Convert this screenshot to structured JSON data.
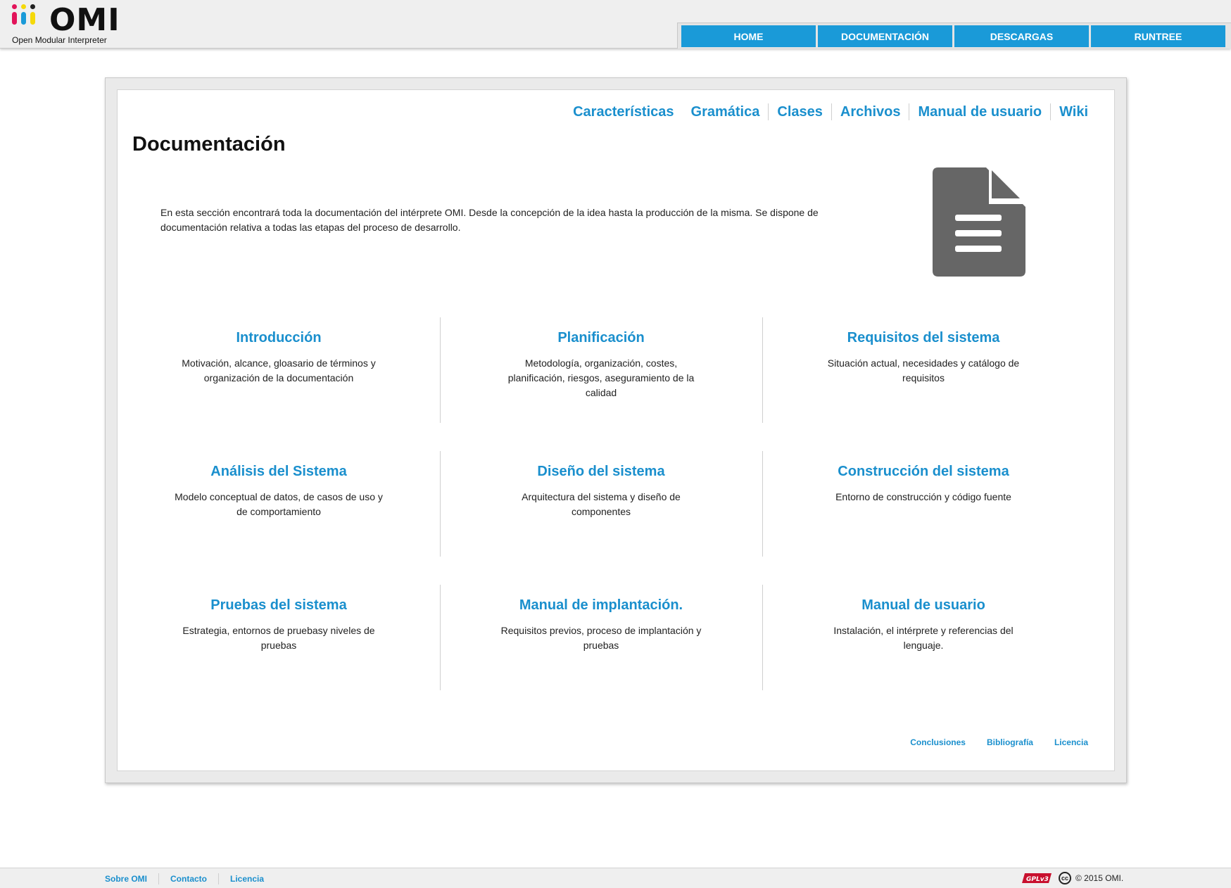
{
  "header": {
    "logo_text": "OMI",
    "logo_subtitle": "Open Modular Interpreter",
    "logo_dot_colors": [
      "#e2145a",
      "#1a9ad8",
      "#f5d90a",
      "#222222"
    ],
    "nav": [
      {
        "label": "HOME"
      },
      {
        "label": "DOCUMENTACIÓN"
      },
      {
        "label": "DESCARGAS"
      },
      {
        "label": "RUNTREE"
      }
    ]
  },
  "subnav": [
    "Características",
    "Gramática",
    "Clases",
    "Archivos",
    "Manual de usuario",
    "Wiki"
  ],
  "main": {
    "title": "Documentación",
    "intro": "En esta sección encontrará toda la documentación del intérprete OMI. Desde la concepción de la idea hasta la producción de la misma. Se dispone de documentación relativa a todas las etapas del proceso de desarrollo.",
    "doc_icon": "document-icon",
    "sections": [
      {
        "title": "Introducción",
        "desc": "Motivación, alcance, gloasario de términos y organización de la documentación"
      },
      {
        "title": "Planificación",
        "desc": "Metodología, organización, costes, planificación, riesgos, aseguramiento de la calidad"
      },
      {
        "title": "Requisitos del sistema",
        "desc": "Situación actual, necesidades y catálogo de requisitos"
      },
      {
        "title": "Análisis del Sistema",
        "desc": "Modelo conceptual de datos, de casos de uso y de comportamiento"
      },
      {
        "title": "Diseño del sistema",
        "desc": "Arquitectura del sistema y diseño de componentes"
      },
      {
        "title": "Construcción del sistema",
        "desc": "Entorno de construcción y código fuente"
      },
      {
        "title": "Pruebas del sistema",
        "desc": "Estrategia, entornos de pruebasy niveles de pruebas"
      },
      {
        "title": "Manual de implantación.",
        "desc": "Requisitos previos, proceso de implantación y pruebas"
      },
      {
        "title": "Manual de usuario",
        "desc": "Instalación, el intérprete y referencias del lenguaje."
      }
    ],
    "bottom_links": [
      "Conclusiones",
      "Bibliografía",
      "Licencia"
    ]
  },
  "footer": {
    "links": [
      "Sobre OMI",
      "Contacto",
      "Licencia"
    ],
    "gpl_text": "GPLv3",
    "cc_text": "cc",
    "copyright": "© 2015 OMI."
  },
  "colors": {
    "accent": "#1a9ad8",
    "link": "#1a8fcd",
    "icon_gray": "#666666"
  }
}
